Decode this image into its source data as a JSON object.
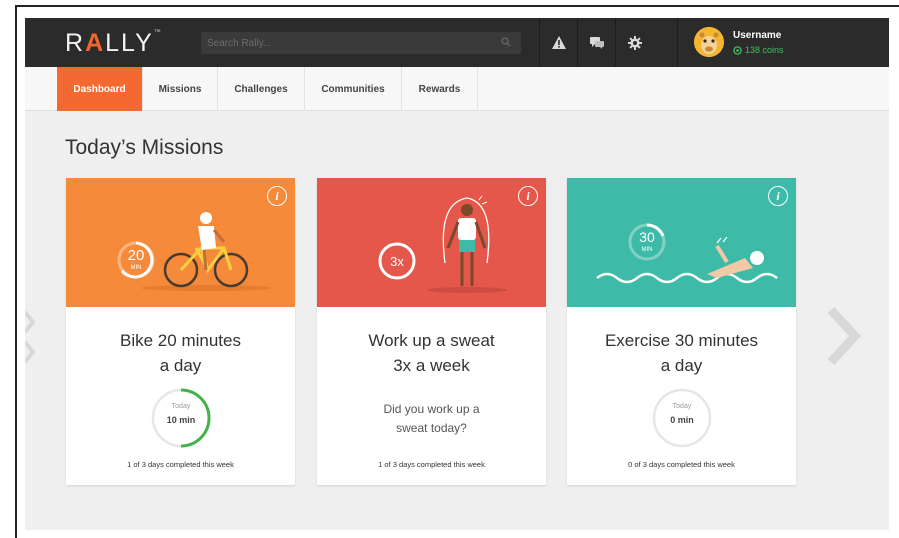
{
  "header": {
    "logo_text_1": "R",
    "logo_text_2": "A",
    "logo_text_3": "LLY",
    "search_placeholder": "Search Rally...",
    "user": {
      "name": "Username",
      "coins": "138 coins"
    }
  },
  "nav": {
    "tabs": [
      {
        "label": "Dashboard",
        "active": true
      },
      {
        "label": "Missions"
      },
      {
        "label": "Challenges"
      },
      {
        "label": "Communities"
      },
      {
        "label": "Rewards"
      }
    ]
  },
  "main": {
    "title": "Today’s Missions",
    "cards": [
      {
        "color": "#f58a3a",
        "badge": "20",
        "badge_unit": "MIN",
        "title_line1": "Bike 20 minutes",
        "title_line2": "a day",
        "ring_label": "Today",
        "ring_value": "10 min",
        "progress_fraction": 0.5,
        "progress_text": "1 of 3 days completed this week"
      },
      {
        "color": "#e5574a",
        "badge": "3x",
        "title_line1": "Work up a sweat",
        "title_line2": "3x a week",
        "question_line1": "Did you work up a",
        "question_line2": "sweat today?",
        "progress_text": "1 of 3 days completed this week"
      },
      {
        "color": "#3dbaa8",
        "badge": "30",
        "badge_unit": "MIN",
        "title_line1": "Exercise 30 minutes",
        "title_line2": "a day",
        "ring_label": "Today",
        "ring_value": "0 min",
        "progress_fraction": 0,
        "progress_text": "0 of 3 days completed this week"
      }
    ]
  },
  "colors": {
    "accent": "#f26a32",
    "topbar": "#2b2b2b",
    "coin_green": "#3fbf5f"
  }
}
